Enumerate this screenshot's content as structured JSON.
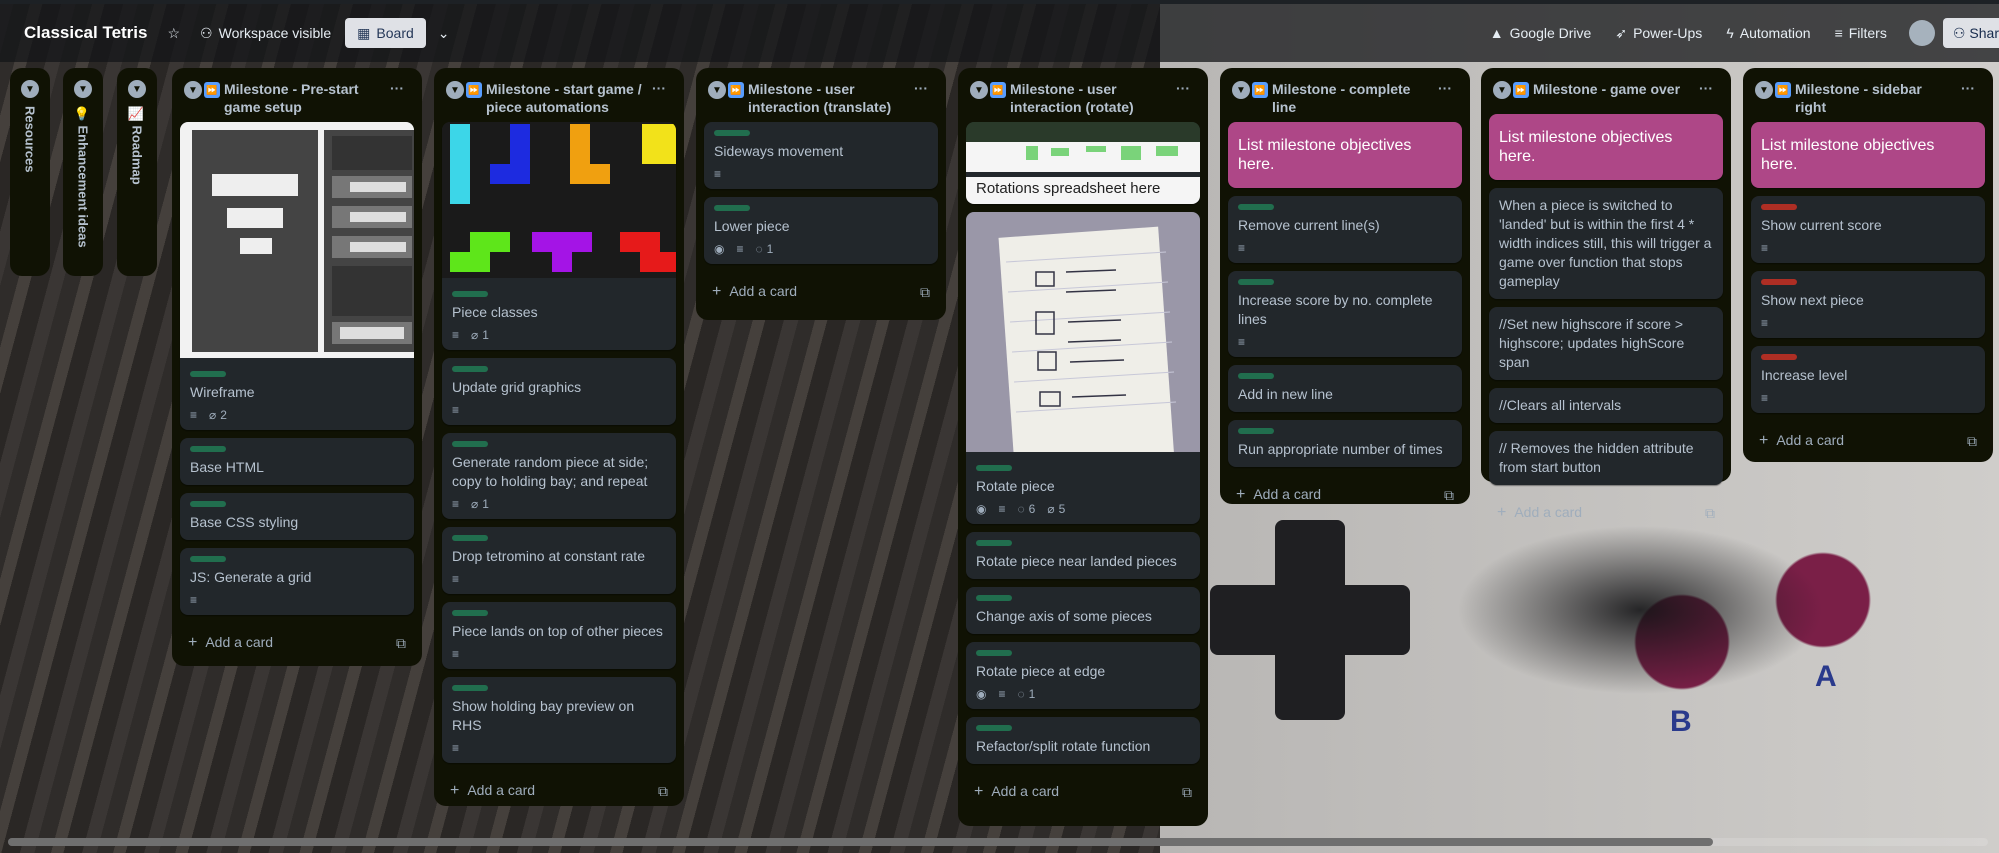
{
  "header": {
    "title": "Classical Tetris",
    "star_icon": "star-icon",
    "visibility_label": "Workspace visible",
    "view_label": "Board",
    "google_drive": "Google Drive",
    "power_ups": "Power-Ups",
    "automation": "Automation",
    "filters": "Filters",
    "share_label": "Shar"
  },
  "collapsed_lists": [
    {
      "label": "Resources"
    },
    {
      "label": "💡 Enhancement ideas"
    },
    {
      "label": "📈 Roadmap"
    }
  ],
  "lists": [
    {
      "title": "Milestone - Pre-start game setup",
      "cards": [
        {
          "title": "Wireframe",
          "attachments": "2"
        },
        {
          "title": "Base HTML"
        },
        {
          "title": "Base CSS styling"
        },
        {
          "title": "JS: Generate a grid"
        }
      ]
    },
    {
      "title": "Milestone - start game / piece automations",
      "cards": [
        {
          "title": "Piece classes",
          "attachments": "1"
        },
        {
          "title": "Update grid graphics"
        },
        {
          "title": "Generate random piece at side; copy to holding bay; and repeat",
          "attachments": "1"
        },
        {
          "title": "Drop tetromino at constant rate"
        },
        {
          "title": "Piece lands on top of other pieces"
        },
        {
          "title": "Show holding bay preview on RHS"
        }
      ]
    },
    {
      "title": "Milestone - user interaction (translate)",
      "cards": [
        {
          "title": "Sideways movement"
        },
        {
          "title": "Lower piece",
          "comments": "1"
        }
      ]
    },
    {
      "title": "Milestone - user interaction (rotate)",
      "cards": [
        {
          "title": "Rotations spreadsheet here"
        },
        {
          "title": "Rotate piece",
          "comments": "6",
          "attachments": "5"
        },
        {
          "title": "Rotate piece near landed pieces"
        },
        {
          "title": "Change axis of some pieces"
        },
        {
          "title": "Rotate piece at edge",
          "comments": "1"
        },
        {
          "title": "Refactor/split rotate function"
        }
      ]
    },
    {
      "title": "Milestone - complete line",
      "cards": [
        {
          "title": "List milestone objectives here."
        },
        {
          "title": "Remove current line(s)"
        },
        {
          "title": "Increase score by no. complete lines"
        },
        {
          "title": "Add in new line"
        },
        {
          "title": "Run appropriate number of times"
        }
      ]
    },
    {
      "title": "Milestone - game over",
      "cards": [
        {
          "title": "List milestone objectives here."
        },
        {
          "title": "When a piece is switched to 'landed' but is within the first 4 * width indices still, this will trigger a game over function that stops gameplay"
        },
        {
          "title": "//Set new highscore if score > highscore; updates highScore span"
        },
        {
          "title": "//Clears all intervals"
        },
        {
          "title": "// Removes the hidden attribute from start button"
        }
      ]
    },
    {
      "title": "Milestone - sidebar right",
      "cards": [
        {
          "title": "List milestone objectives here."
        },
        {
          "title": "Show current score"
        },
        {
          "title": "Show next piece"
        },
        {
          "title": "Increase level"
        }
      ]
    }
  ],
  "add_card_label": "Add a card",
  "console_buttons": {
    "a": "A",
    "b": "B"
  },
  "colors": {
    "label_green": "#216e4e",
    "label_red": "#ae2e24",
    "pink_card": "#ae4787",
    "list_bg": "#101204",
    "card_bg": "#22272b"
  }
}
